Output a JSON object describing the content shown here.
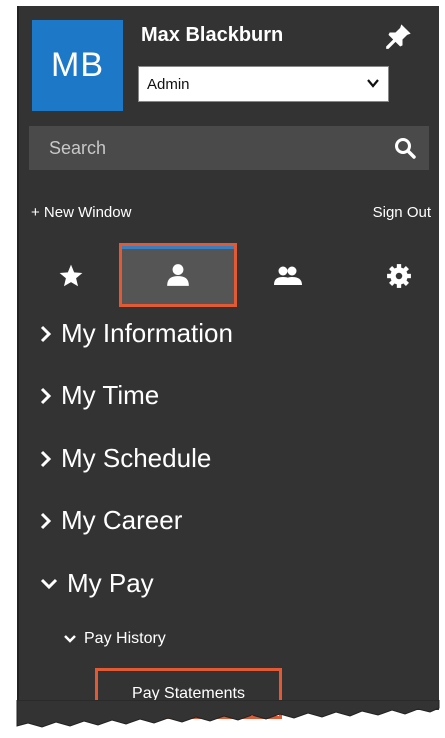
{
  "user": {
    "initials": "MB",
    "name": "Max Blackburn",
    "role": "Admin",
    "pin_icon": "pin-icon",
    "avatar_color": "#1e78c8"
  },
  "search": {
    "placeholder": "Search",
    "icon": "search-icon"
  },
  "links": {
    "new_window": "+ New Window",
    "sign_out": "Sign Out"
  },
  "tabs": [
    {
      "name": "favorites",
      "icon": "star-icon",
      "active": false
    },
    {
      "name": "my-info",
      "icon": "person-icon",
      "active": true
    },
    {
      "name": "team",
      "icon": "people-icon",
      "active": false
    },
    {
      "name": "settings",
      "icon": "gear-icon",
      "active": false
    }
  ],
  "nav": {
    "items": [
      {
        "label": "My Information",
        "expanded": false
      },
      {
        "label": "My Time",
        "expanded": false
      },
      {
        "label": "My Schedule",
        "expanded": false
      },
      {
        "label": "My Career",
        "expanded": false
      },
      {
        "label": "My Pay",
        "expanded": true
      }
    ],
    "sub_item": {
      "label": "Pay History",
      "expanded": true
    },
    "leaf_item": {
      "label": "Pay Statements"
    }
  },
  "colors": {
    "panel": "#333333",
    "highlight": "#e05a35",
    "active_bar": "#3a7fc0"
  }
}
